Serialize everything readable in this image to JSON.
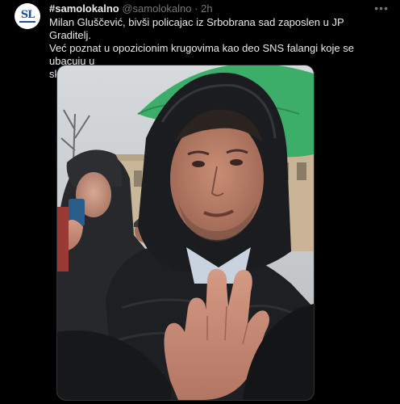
{
  "author": {
    "display_name": "#samolokalno",
    "handle": "@samolokalno",
    "separator": "·",
    "time": "2h",
    "avatar_logo_text": "SL"
  },
  "more_icon": "more-horizontal-icon",
  "tweet_text": [
    "Milan Gluščević, bivši policajac iz Srbobrana sad zaposlen u JP Graditelj.",
    "Već poznat u opozicionim krugovima kao deo SNS falangi koje se ubacuju u",
    "skupove da prave incidente."
  ],
  "media": {
    "kind": "photo",
    "colors": {
      "sky": "#cfd3d6",
      "umbrella": "#3dae6a",
      "jacket": "#1e1f22",
      "skin": "#b98068"
    }
  }
}
